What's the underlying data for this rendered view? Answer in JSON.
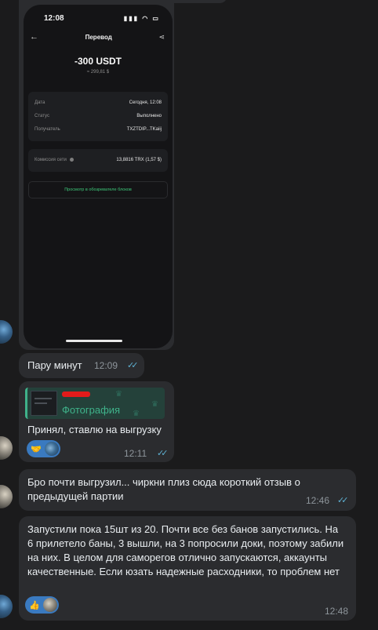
{
  "screenshot": {
    "status_bar": {
      "time": "12:08"
    },
    "header": {
      "title": "Перевод"
    },
    "amount": "-300 USDT",
    "amount_fiat": "≈ 299,81 $",
    "details": [
      {
        "key": "Дата",
        "value": "Сегодня, 12:08"
      },
      {
        "key": "Статус",
        "value": "Выполнено"
      },
      {
        "key": "Получатель",
        "value": "TXZTDIP...TKaiij"
      }
    ],
    "fee": {
      "key": "Комиссия сети",
      "value": "13,8816 TRX (1,57 $)"
    },
    "explorer_link": "Просмотр в обозревателе блоков"
  },
  "messages": [
    {
      "text": "Пару минут",
      "time": "12:09"
    },
    {
      "reply_label": "Фотография",
      "text": "Принял, ставлю на выгрузку",
      "time": "12:11",
      "reaction_emoji": "🤝"
    },
    {
      "text": "Бро почти выгрузил... чиркни плиз сюда короткий отзыв о предыдущей партии",
      "time": "12:46"
    },
    {
      "text": "Запустили пока 15шт из 20. Почти все без банов запустились. На 6 прилетело баны, 3 вышли, на 3 попросили доки, поэтому забили на них. В целом для саморегов отлично запускаются, аккаунты качественные. Если юзать надежные расходники, то проблем нет",
      "time": "12:48",
      "reaction_emoji": "👍"
    }
  ],
  "colors": {
    "background": "#1b1b1c",
    "bubble": "#2b2c2f",
    "read_ticks": "#5fb1d3",
    "reply_accent": "#3fb28a",
    "reaction_chip": "#3a7ac0",
    "explorer_link": "#3ec97a"
  },
  "icons": [
    "back-arrow-icon",
    "share-icon",
    "info-icon",
    "read-receipt-icon",
    "crown-icon",
    "handshake-icon",
    "thumbs-up-icon"
  ]
}
